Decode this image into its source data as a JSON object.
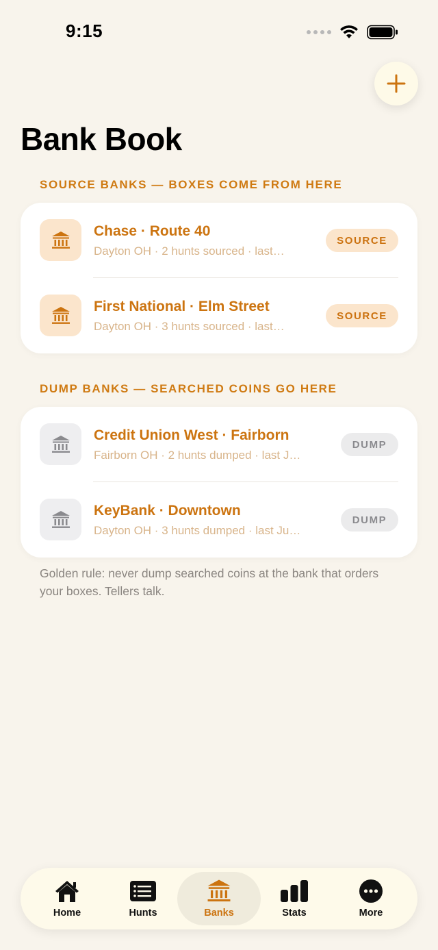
{
  "status_bar": {
    "time": "9:15"
  },
  "page": {
    "title": "Bank Book"
  },
  "sections": {
    "source": {
      "label": "SOURCE BANKS — BOXES COME FROM HERE",
      "items": [
        {
          "title": "Chase · Route 40",
          "subtitle": "Dayton OH · 2 hunts sourced · last…",
          "badge": "SOURCE"
        },
        {
          "title": "First National · Elm Street",
          "subtitle": "Dayton OH · 3 hunts sourced · last…",
          "badge": "SOURCE"
        }
      ]
    },
    "dump": {
      "label": "DUMP BANKS — SEARCHED COINS GO HERE",
      "items": [
        {
          "title": "Credit Union West · Fairborn",
          "subtitle": "Fairborn OH · 2 hunts dumped · last J…",
          "badge": "DUMP"
        },
        {
          "title": "KeyBank · Downtown",
          "subtitle": "Dayton OH · 3 hunts dumped · last Ju…",
          "badge": "DUMP"
        }
      ]
    }
  },
  "footnote": "Golden rule: never dump searched coins at the bank that orders your boxes. Tellers talk.",
  "tabs": [
    {
      "label": "Home",
      "icon": "house-icon"
    },
    {
      "label": "Hunts",
      "icon": "list-icon"
    },
    {
      "label": "Banks",
      "icon": "bank-icon",
      "active": true
    },
    {
      "label": "Stats",
      "icon": "bar-chart-icon"
    },
    {
      "label": "More",
      "icon": "ellipsis-circle-icon"
    }
  ],
  "colors": {
    "accent": "#CC7410",
    "background": "#F8F4EC",
    "source_badge_bg": "#FBE5CC",
    "dump_badge_bg": "#EBEBEC"
  }
}
